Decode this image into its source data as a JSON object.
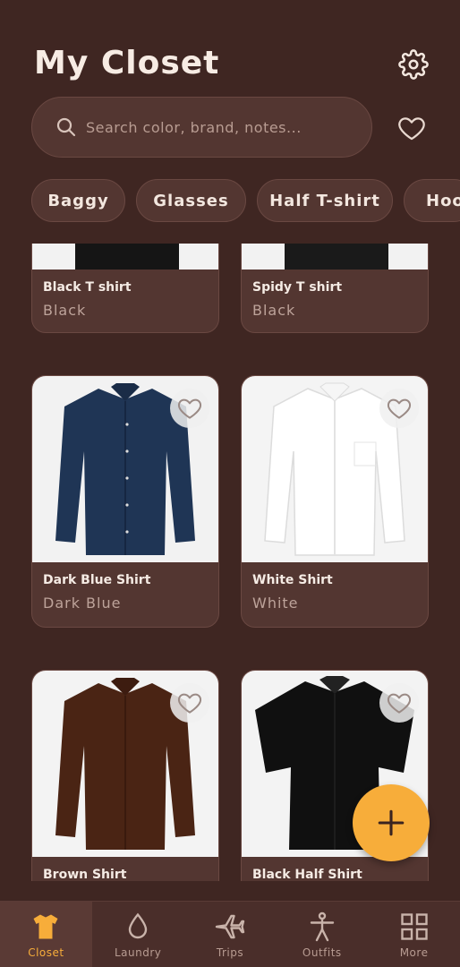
{
  "header": {
    "title": "My Closet"
  },
  "search": {
    "placeholder": "Search color, brand, notes..."
  },
  "chips": [
    "Baggy",
    "Glasses",
    "Half T-shirt",
    "Hoo"
  ],
  "items": [
    {
      "name": "Black T shirt",
      "color": "Black"
    },
    {
      "name": "Spidy T shirt",
      "color": "Black"
    },
    {
      "name": "Dark Blue Shirt",
      "color": "Dark Blue"
    },
    {
      "name": "White Shirt",
      "color": "White"
    },
    {
      "name": "Brown Shirt",
      "color": ""
    },
    {
      "name": "Black Half Shirt",
      "color": ""
    }
  ],
  "tabs": [
    {
      "label": "Closet",
      "icon": "tshirt-icon",
      "active": true
    },
    {
      "label": "Laundry",
      "icon": "water-drop-icon",
      "active": false
    },
    {
      "label": "Trips",
      "icon": "airplane-icon",
      "active": false
    },
    {
      "label": "Outfits",
      "icon": "person-icon",
      "active": false
    },
    {
      "label": "More",
      "icon": "grid-icon",
      "active": false
    }
  ],
  "colors": {
    "background": "#3f2622",
    "surface": "#533631",
    "accent": "#f7ad3a",
    "text": "#f3e7df",
    "muted": "#b89c92"
  }
}
